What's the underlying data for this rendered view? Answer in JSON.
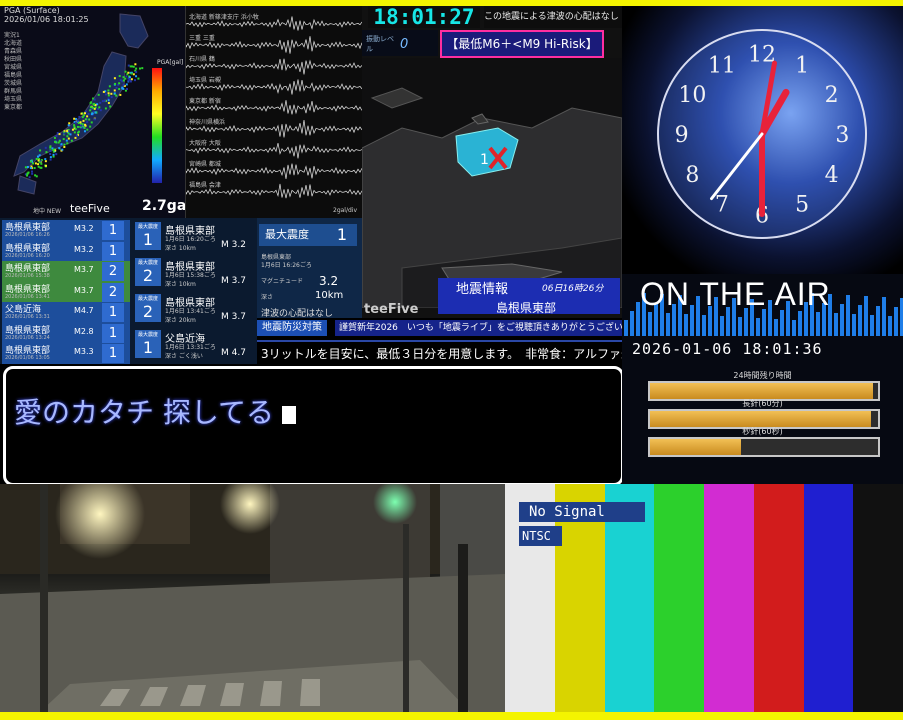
{
  "pga_map": {
    "header": "PGA (Surface)",
    "timestamp": "2026/01/06 18:01:25",
    "legend_rows": [
      "実況1",
      "北海道",
      "青森県",
      "秋田県",
      "宮城県",
      "福島県",
      "茨城県",
      "群馬県",
      "埼玉県",
      "東京都"
    ],
    "scale_label": "PGA[gal]",
    "scale_ticks": [
      "1000",
      "500",
      "200",
      "100",
      "50",
      "20",
      "10",
      "5",
      "2",
      "1",
      "0.5",
      "0.2",
      "0.1"
    ],
    "reading_label": "2.7gal",
    "reading_value": "2.7gal"
  },
  "waveforms": {
    "stations": [
      "北海道 新篠津支庁 浜小牧",
      "三重 三重",
      "石川県 鶴",
      "埼玉県 岩槻",
      "東京都 新宿",
      "神奈川県横浜",
      "大阪府 大阪",
      "宮崎県 都城",
      "福島県 会津"
    ],
    "scale_label": "2gal/div"
  },
  "shindo_map": {
    "clock": "18:01:27",
    "tsunami_note": "この地震による津波の心配はなし",
    "level_label": "振動レベル",
    "level_value": "0",
    "risk_label": "【最低M6＋<M9 Hi-Risk】",
    "epicenter_shindo": "1",
    "info_title": "地震情報",
    "info_time": "06日16時26分",
    "info_region": "島根県東部",
    "brand": "teeFive"
  },
  "quake_list": {
    "brand": "teeFive",
    "brand_prefix": "地中 NEW",
    "items": [
      {
        "name": "島根県東部",
        "date": "2026/01/06 16:26",
        "mag": "M3.2",
        "shindo": "1",
        "color": "#1d4e9c"
      },
      {
        "name": "島根県東部",
        "date": "2026/01/06 16:20",
        "mag": "M3.2",
        "shindo": "1",
        "color": "#1d4e9c"
      },
      {
        "name": "島根県東部",
        "date": "2026/01/06 15:38",
        "mag": "M3.7",
        "shindo": "2",
        "color": "#3e8a3e"
      },
      {
        "name": "島根県東部",
        "date": "2026/01/06 13:41",
        "mag": "M3.7",
        "shindo": "2",
        "color": "#3e8a3e"
      },
      {
        "name": "父島近海",
        "date": "2026/01/06 13:31",
        "mag": "M4.7",
        "shindo": "1",
        "color": "#1d4e9c"
      },
      {
        "name": "島根県東部",
        "date": "2026/01/06 13:24",
        "mag": "M2.8",
        "shindo": "1",
        "color": "#1d4e9c"
      },
      {
        "name": "島根県東部",
        "date": "2026/01/06 13:05",
        "mag": "M3.3",
        "shindo": "1",
        "color": "#1d4e9c"
      }
    ]
  },
  "quake_detail": {
    "badge_label": "最大震度",
    "items": [
      {
        "name": "島根県東部",
        "date": "1月6日 16:20ごろ",
        "depth": "深さ 10km",
        "mag": "M 3.2",
        "shindo": "1"
      },
      {
        "name": "島根県東部",
        "date": "1月6日 15:38ごろ",
        "depth": "深さ 10km",
        "mag": "M 3.7",
        "shindo": "2"
      },
      {
        "name": "島根県東部",
        "date": "1月6日 13:41ごろ",
        "depth": "深さ 20km",
        "mag": "M 3.7",
        "shindo": "2"
      },
      {
        "name": "父島近海",
        "date": "1月6日 13:31ごろ",
        "depth": "深さ ごく浅い",
        "mag": "M 4.7",
        "shindo": "1"
      }
    ]
  },
  "max_shindo": {
    "label": "最大震度",
    "value": "1",
    "region": "島根県東部",
    "time": "1月6日 16:26ごろ",
    "mag_label": "マグニチュード",
    "mag_value": "3.2",
    "depth_label": "深さ",
    "depth_value": "10km",
    "tsunami": "津波の心配はなし"
  },
  "ticker": {
    "badge": "地震防災対策",
    "headline": "謹賀新年2026　いつも「地震ライブ」をご視聴頂きありがとうございます!",
    "scroll": "3リットルを目安に、最低３日分を用意します。　非常食：アルファ米"
  },
  "lyrics": {
    "text": "愛のカタチ 探してる"
  },
  "clock_panel": {
    "numbers": [
      "12",
      "1",
      "2",
      "3",
      "4",
      "5",
      "6",
      "7",
      "8",
      "9",
      "10",
      "11"
    ]
  },
  "onair": {
    "title": "ON THE AIR",
    "datetime": "2026-01-06 18:01:36",
    "bars": [
      {
        "label": "24時間残り時間",
        "fill": 0.98
      },
      {
        "label": "長針(60分)",
        "fill": 0.97
      },
      {
        "label": "秒針(60秒)",
        "fill": 0.4
      }
    ]
  },
  "street_cam": {},
  "color_bars": {
    "no_signal": "No Signal",
    "format": "NTSC",
    "colors": [
      "#e8e8e8",
      "#d9d400",
      "#19d2d2",
      "#2cd02c",
      "#d22cd2",
      "#d21c1c",
      "#1f1fd0",
      "#111111"
    ]
  }
}
